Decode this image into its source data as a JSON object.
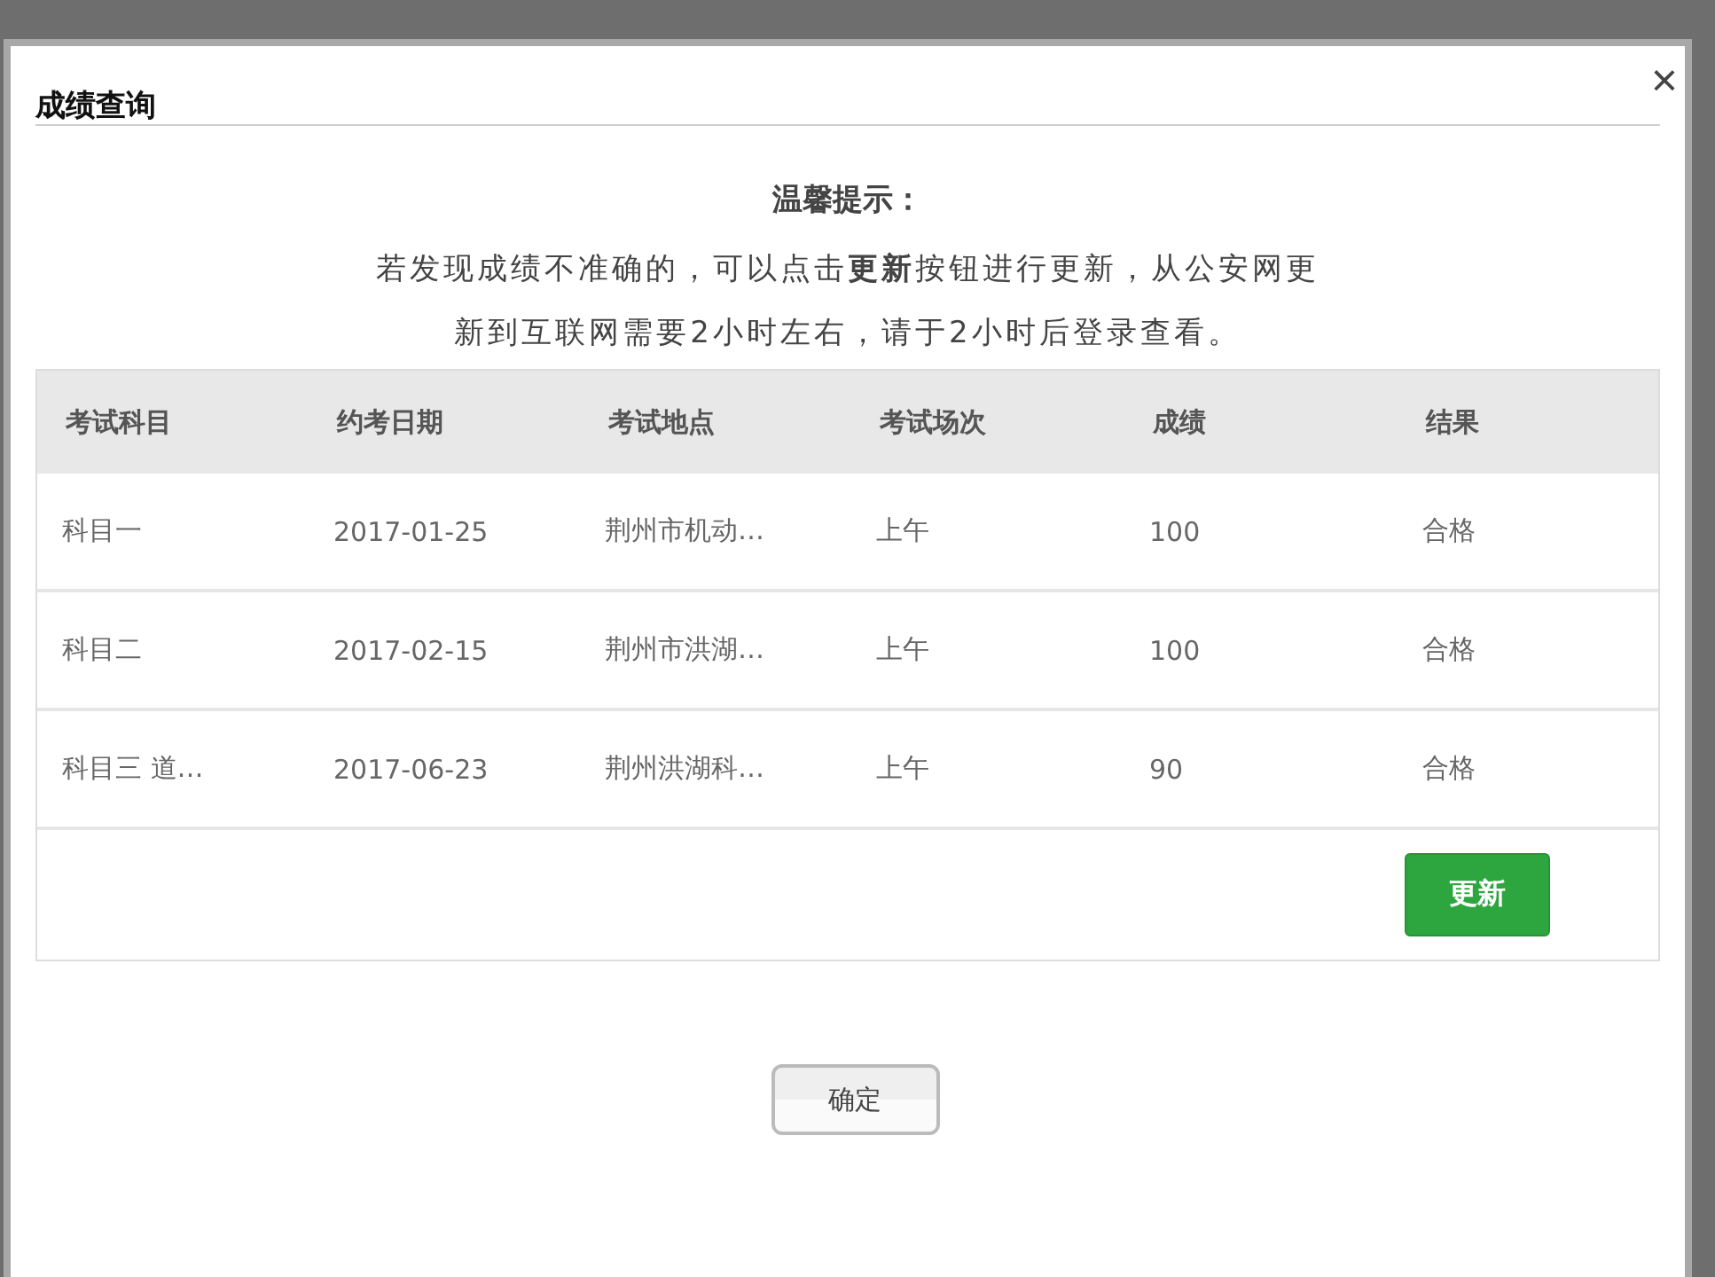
{
  "dialog": {
    "title": "成绩查询",
    "close": "×"
  },
  "notice": {
    "heading": "温馨提示：",
    "lines": [
      "若发现成绩不准确的，可以点击**更新**按钮进行更新，从公安网更",
      "新到互联网需要2小时左右，请于2小时后登录查看。"
    ]
  },
  "table": {
    "columns": [
      "考试科目",
      "约考日期",
      "考试地点",
      "考试场次",
      "成绩",
      "结果"
    ],
    "rows": [
      [
        "科目一",
        "2017-01-25",
        "荆州市机动…",
        "上午",
        "100",
        "合格"
      ],
      [
        "科目二",
        "2017-02-15",
        "荆州市洪湖…",
        "上午",
        "100",
        "合格"
      ],
      [
        "科目三 道…",
        "2017-06-23",
        "荆州洪湖科…",
        "上午",
        "90",
        "合格"
      ]
    ],
    "update_button": "更新"
  },
  "confirm_button": "确定"
}
